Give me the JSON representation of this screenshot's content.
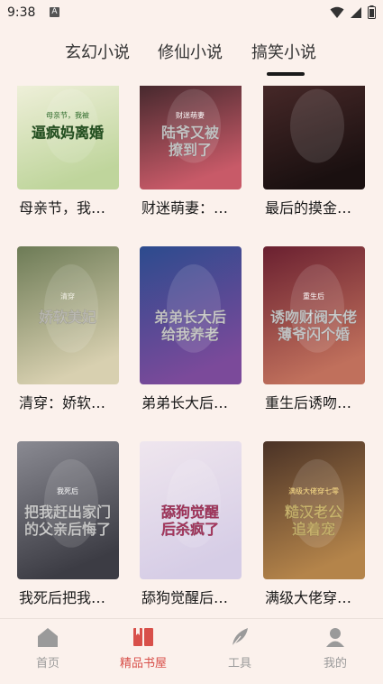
{
  "status": {
    "time": "9:38",
    "a_badge": "A"
  },
  "tabs": [
    {
      "label": "玄幻小说",
      "active": false
    },
    {
      "label": "修仙小说",
      "active": false
    },
    {
      "label": "搞笑小说",
      "active": true
    }
  ],
  "books": [
    {
      "title": "母亲节，我…",
      "cover_text": "逼疯妈离婚",
      "cover_sub": "母亲节，我被",
      "bg1": "#f3f2df",
      "bg2": "#bfd59c",
      "fg": "#2e6a2a"
    },
    {
      "title": "财迷萌妻：…",
      "cover_text": "陆爷又被撩到了",
      "cover_sub": "财迷萌妻",
      "bg1": "#3a2428",
      "bg2": "#c85a68",
      "fg": "#ffffff"
    },
    {
      "title": "最后的摸金…",
      "cover_text": "",
      "cover_sub": "",
      "bg1": "#4a2a2a",
      "bg2": "#1a1010",
      "fg": "#ffffff"
    },
    {
      "title": "清穿：娇软…",
      "cover_text": "娇软美妃",
      "cover_sub": "清穿",
      "bg1": "#6d7b56",
      "bg2": "#d8d0b0",
      "fg": "#f2f0e6"
    },
    {
      "title": "弟弟长大后…",
      "cover_text": "弟弟长大后给我养老",
      "cover_sub": "",
      "bg1": "#2c4b8e",
      "bg2": "#7b4a9a",
      "fg": "#ffffff"
    },
    {
      "title": "重生后诱吻…",
      "cover_text": "诱吻财阀大佬薄爷闪个婚",
      "cover_sub": "重生后",
      "bg1": "#6a2030",
      "bg2": "#c0705c",
      "fg": "#ffffff"
    },
    {
      "title": "我死后把我…",
      "cover_text": "把我赶出家门的父亲后悔了",
      "cover_sub": "我死后",
      "bg1": "#8a8a92",
      "bg2": "#3c3c44",
      "fg": "#ffffff"
    },
    {
      "title": "舔狗觉醒后…",
      "cover_text": "舔狗觉醒后杀疯了",
      "cover_sub": "",
      "bg1": "#efe6ee",
      "bg2": "#d6cde6",
      "fg": "#d44477"
    },
    {
      "title": "满级大佬穿…",
      "cover_text": "糙汉老公追着宠",
      "cover_sub": "满级大佬穿七零",
      "bg1": "#4a3226",
      "bg2": "#b4844a",
      "fg": "#ffe28a"
    }
  ],
  "nav": [
    {
      "label": "首页",
      "icon": "home-icon",
      "active": false
    },
    {
      "label": "精品书屋",
      "icon": "book-icon",
      "active": true
    },
    {
      "label": "工具",
      "icon": "feather-icon",
      "active": false
    },
    {
      "label": "我的",
      "icon": "user-icon",
      "active": false
    }
  ],
  "colors": {
    "accent": "#d8504a",
    "inactive": "#9a9a9a"
  }
}
